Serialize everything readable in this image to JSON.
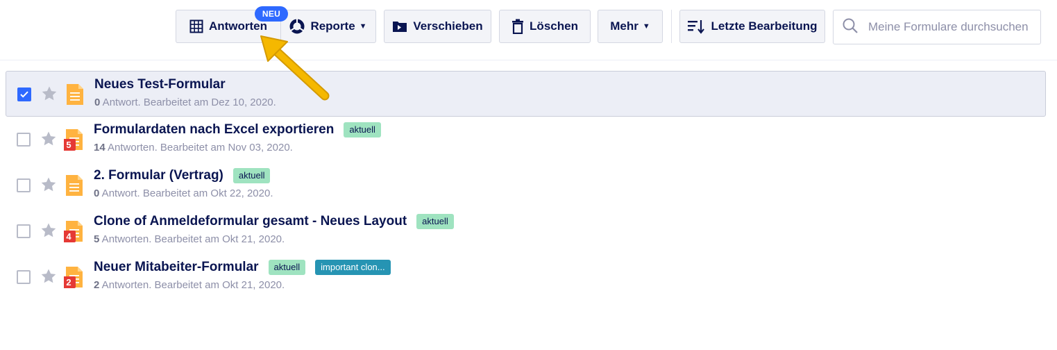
{
  "toolbar": {
    "responses_label": "Antworten",
    "new_badge": "NEU",
    "reports_label": "Reporte",
    "move_label": "Verschieben",
    "delete_label": "Löschen",
    "more_label": "Mehr",
    "sort_label": "Letzte Bearbeitung",
    "search_placeholder": "Meine Formulare durchsuchen"
  },
  "forms": [
    {
      "title": "Neues Test-Formular",
      "count": "0",
      "meta": " Antwort. Bearbeitet am Dez 10, 2020.",
      "badge": "",
      "tags": []
    },
    {
      "title": "Formulardaten nach Excel exportieren",
      "count": "14",
      "meta": " Antworten. Bearbeitet am Nov 03, 2020.",
      "badge": "5",
      "tags": [
        "aktuell"
      ]
    },
    {
      "title": "2. Formular (Vertrag)",
      "count": "0",
      "meta": " Antwort. Bearbeitet am Okt 22, 2020.",
      "badge": "",
      "tags": [
        "aktuell"
      ]
    },
    {
      "title": "Clone of Anmeldeformular gesamt - Neues Layout",
      "count": "5",
      "meta": " Antworten. Bearbeitet am Okt 21, 2020.",
      "badge": "4",
      "tags": [
        "aktuell"
      ]
    },
    {
      "title": "Neuer Mitabeiter-Formular",
      "count": "2",
      "meta": " Antworten. Bearbeitet am Okt 21, 2020.",
      "badge": "2",
      "tags": [
        "aktuell",
        "important clon..."
      ]
    }
  ],
  "colors": {
    "accent": "#2e69ff",
    "form_icon": "#ffb340",
    "badge_red": "#e53935",
    "tag_green": "#9fe3c0",
    "tag_teal": "#2694b3",
    "arrow": "#f5b800"
  }
}
